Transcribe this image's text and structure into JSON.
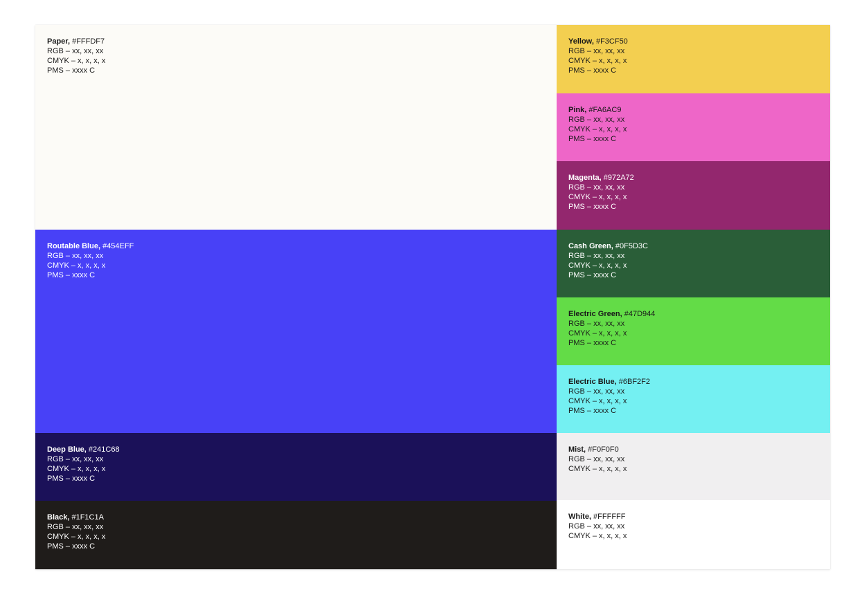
{
  "swatches": {
    "paper": {
      "name": "Paper,",
      "hex": " #FFFDF7",
      "rgb": "RGB – xx, xx, xx",
      "cmyk": "CMYK – x, x, x, x",
      "pms": "PMS – xxxx C",
      "bg": "#FCFBF7",
      "text_color": "#1a1a1a"
    },
    "rblue": {
      "name": "Routable Blue,",
      "hex": " #454EFF",
      "rgb": "RGB – xx, xx, xx",
      "cmyk": "CMYK – x, x, x, x",
      "pms": "PMS – xxxx C",
      "bg": "#4841F7",
      "text_color": "#ffffff"
    },
    "deep": {
      "name": "Deep Blue,",
      "hex": " #241C68",
      "rgb": "RGB – xx, xx, xx",
      "cmyk": "CMYK – x, x, x, x",
      "pms": "PMS – xxxx C",
      "bg": "#1B1159",
      "text_color": "#ffffff"
    },
    "black": {
      "name": "Black,",
      "hex": " #1F1C1A",
      "rgb": "RGB – xx, xx, xx",
      "cmyk": "CMYK – x, x, x, x",
      "pms": "PMS – xxxx C",
      "bg": "#1F1C1A",
      "text_color": "#ffffff"
    },
    "yellow": {
      "name": "Yellow,",
      "hex": " #F3CF50",
      "rgb": "RGB – xx, xx, xx",
      "cmyk": "CMYK – x, x, x, x",
      "pms": "PMS – xxxx C",
      "bg": "#F3CF50",
      "text_color": "#1a1a1a"
    },
    "pink": {
      "name": "Pink,",
      "hex": " #FA6AC9",
      "rgb": "RGB – xx, xx, xx",
      "cmyk": "CMYK – x, x, x, x",
      "pms": "PMS – xxxx C",
      "bg": "#EE66C8",
      "text_color": "#1a1a1a"
    },
    "magenta": {
      "name": "Magenta,",
      "hex": " #972A72",
      "rgb": "RGB – xx, xx, xx",
      "cmyk": "CMYK – x, x, x, x",
      "pms": "PMS – xxxx C",
      "bg": "#93276E",
      "text_color": "#ffffff"
    },
    "cash": {
      "name": "Cash Green,",
      "hex": " #0F5D3C",
      "rgb": "RGB – xx, xx, xx",
      "cmyk": "CMYK – x, x, x, x",
      "pms": "PMS – xxxx C",
      "bg": "#2A5E38",
      "text_color": "#ffffff"
    },
    "egreen": {
      "name": "Electric Green,",
      "hex": " #47D944",
      "rgb": "RGB – xx, xx, xx",
      "cmyk": "CMYK – x, x, x, x",
      "pms": "PMS – xxxx C",
      "bg": "#63DC47",
      "text_color": "#1a1a1a"
    },
    "eblue": {
      "name": "Electric Blue,",
      "hex": " #6BF2F2",
      "rgb": "RGB – xx, xx, xx",
      "cmyk": "CMYK – x, x, x, x",
      "pms": "PMS – xxxx C",
      "bg": "#74F0F2",
      "text_color": "#1a1a1a"
    },
    "mist": {
      "name": "Mist,",
      "hex": " #F0F0F0",
      "rgb": "RGB – xx, xx, xx",
      "cmyk": "CMYK – x, x, x, x",
      "bg": "#F0EFF0",
      "text_color": "#1a1a1a"
    },
    "white": {
      "name": "White,",
      "hex": " #FFFFFF",
      "rgb": "RGB – xx, xx, xx",
      "cmyk": "CMYK – x, x, x, x",
      "bg": "#FFFFFF",
      "text_color": "#1a1a1a"
    }
  }
}
